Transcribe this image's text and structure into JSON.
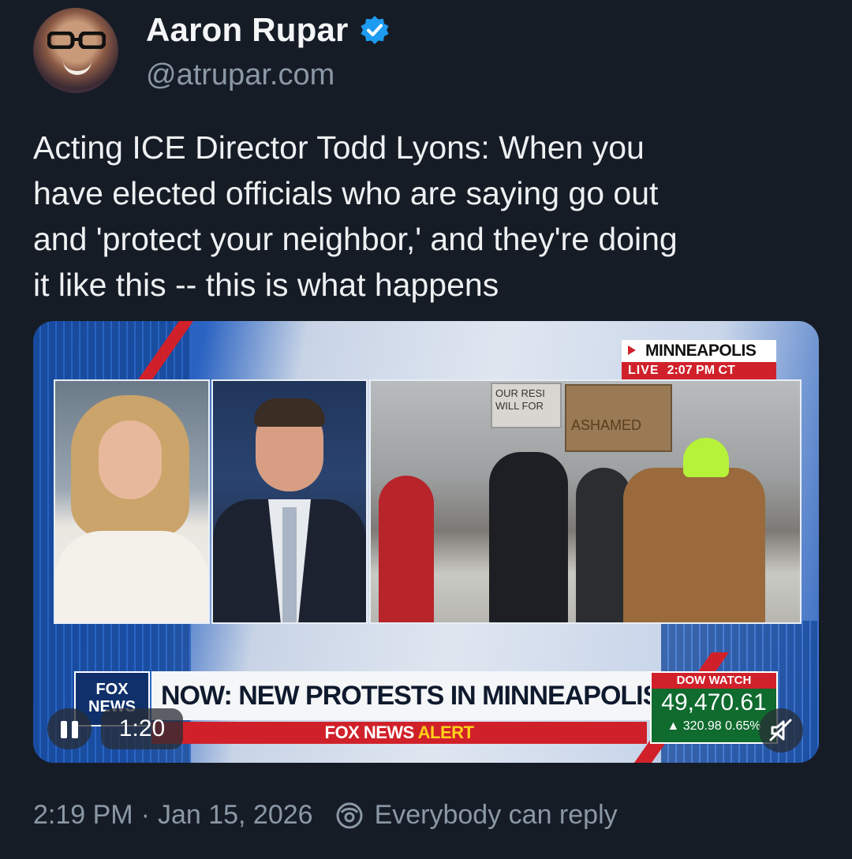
{
  "author": {
    "name": "Aaron Rupar",
    "handle": "@atrupar.com",
    "verified_color": "#1d9bf0"
  },
  "post": {
    "text_lines": [
      "Acting ICE Director Todd Lyons: When you",
      "have elected officials who are saying go out",
      "and 'protect your neighbor,' and they're doing",
      "it like this -- this is what happens"
    ]
  },
  "video": {
    "location": "MINNEAPOLIS",
    "live_label": "LIVE",
    "live_time": "2:07 PM CT",
    "logo_line1": "FOX",
    "logo_line2": "NEWS",
    "headline": "NOW: NEW PROTESTS IN MINNEAPOLIS",
    "alert_part1": "FOX NEWS",
    "alert_part2": "ALERT",
    "dow_label": "DOW WATCH",
    "dow_value": "49,470.61",
    "dow_change": "▲ 320.98 0.65%",
    "sign_text_1": "OUR RESI WILL FOR",
    "sign_text_2": "ASHAMED",
    "elapsed": "1:20",
    "controls": {
      "pause_icon": "pause-icon",
      "mute_icon": "mute-icon"
    }
  },
  "meta": {
    "time": "2:19 PM",
    "separator": "·",
    "date": "Jan 15, 2026",
    "reply_setting": "Everybody can reply"
  },
  "colors": {
    "background": "#161c26",
    "text": "#e7e9ea",
    "muted": "#8b98a5",
    "fox_red": "#d0212a",
    "dow_green": "#0f6b2e"
  }
}
